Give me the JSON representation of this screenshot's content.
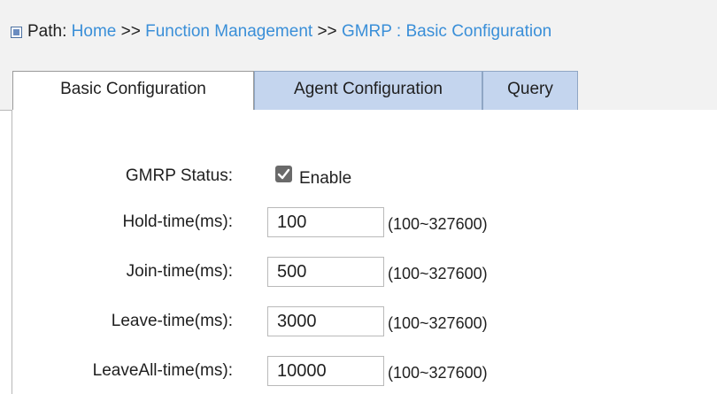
{
  "path": {
    "label": "Path:",
    "home": "Home",
    "sep1": ">>",
    "function_management": "Function Management",
    "sep2": ">>",
    "gmrp": "GMRP",
    "sep3": ":",
    "current": "Basic Configuration"
  },
  "tabs": [
    {
      "label": "Basic Configuration",
      "active": true
    },
    {
      "label": "Agent Configuration",
      "active": false
    },
    {
      "label": "Query",
      "active": false
    }
  ],
  "form": {
    "gmrp_status": {
      "label": "GMRP Status:",
      "checkbox_label": "Enable",
      "checked": true
    },
    "hold_time": {
      "label": "Hold-time(ms):",
      "value": "100",
      "range": "(100~327600)"
    },
    "join_time": {
      "label": "Join-time(ms):",
      "value": "500",
      "range": "(100~327600)"
    },
    "leave_time": {
      "label": "Leave-time(ms):",
      "value": "3000",
      "range": "(100~327600)"
    },
    "leaveall_time": {
      "label": "LeaveAll-time(ms):",
      "value": "10000",
      "range": "(100~327600)"
    }
  },
  "colors": {
    "link": "#3a8fd8",
    "tab_inactive": "#c4d5ee",
    "checkbox": "#6a6a6a"
  },
  "icons": {
    "path": "square-bullet-icon",
    "check": "checkmark-icon"
  }
}
